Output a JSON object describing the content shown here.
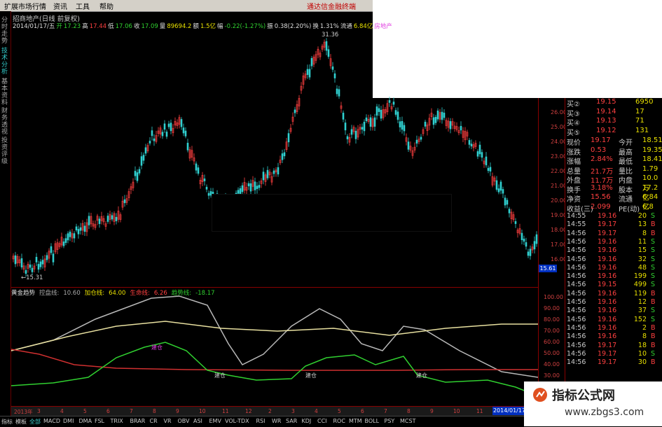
{
  "menubar": {
    "items": [
      "扩展市场行情",
      "资讯",
      "工具",
      "帮助"
    ],
    "ad": "通达信金融终端"
  },
  "left_tabs": [
    {
      "label": "分时走势",
      "active": false
    },
    {
      "label": "技术分析",
      "active": true
    },
    {
      "label": "基本资料",
      "active": false
    },
    {
      "label": "财务透视",
      "active": false
    },
    {
      "label": "投资评级",
      "active": false
    }
  ],
  "chart": {
    "title": "招商地产(日线 前复权)",
    "info": {
      "date": "2014/01/17/五",
      "open_label": "开",
      "open": "17.23",
      "high_label": "高",
      "high": "17.44",
      "low_label": "低",
      "low": "17.06",
      "close_label": "收",
      "close": "17.09",
      "vol_label": "量",
      "vol": "89694.2",
      "amount_label": "额",
      "amount": "1.5亿",
      "change_label": "幅",
      "change": "-0.22(-1.27%)",
      "amplitude_label": "振",
      "amplitude": "0.38(2.20%)",
      "turnover_label": "换",
      "turnover": "1.31%",
      "float_label": "流通",
      "float": "6.84亿",
      "sector": "房地产"
    },
    "max_label": "31.36",
    "min_label": "←15.31",
    "price_ticks": [
      "26.00",
      "25.00",
      "24.00",
      "23.00",
      "22.00",
      "21.00",
      "20.00",
      "19.00",
      "18.00",
      "17.00",
      "16.00"
    ],
    "price_tag": "15.61",
    "indicator": {
      "name": "黄金趋势",
      "l1_label": "控盘线:",
      "l1": "10.60",
      "l2_label": "加仓线:",
      "l2": "64.00",
      "l3_label": "生命线:",
      "l3": "6.26",
      "l4_label": "趋势线:",
      "l4": "-18.17",
      "markers": [
        "建仓",
        "建仓",
        "建仓",
        "建仓"
      ],
      "ticks": [
        "100.00",
        "90.00",
        "80.00",
        "70.00",
        "60.00",
        "50.00",
        "40.00",
        "30.00",
        "20.00",
        "10.00"
      ]
    },
    "time_labels": [
      "2013年",
      "3",
      "4",
      "5",
      "6",
      "7",
      "8",
      "9",
      "10",
      "11",
      "12",
      "2",
      "3",
      "4",
      "5",
      "6",
      "7",
      "8",
      "9",
      "10",
      "11",
      "12"
    ],
    "end_date": "2014/01/17"
  },
  "quote": {
    "bids": [
      {
        "label": "买②",
        "price": "19.15",
        "vol": "6950"
      },
      {
        "label": "买③",
        "price": "19.14",
        "vol": "17"
      },
      {
        "label": "买④",
        "price": "19.13",
        "vol": "71"
      },
      {
        "label": "买⑤",
        "price": "19.12",
        "vol": "131"
      }
    ],
    "stats": [
      {
        "l1": "现价",
        "v1": "19.17",
        "l2": "今开",
        "v2": "18.51"
      },
      {
        "l1": "涨跌",
        "v1": "0.53",
        "l2": "最高",
        "v2": "19.35"
      },
      {
        "l1": "涨幅",
        "v1": "2.84%",
        "l2": "最低",
        "v2": "18.41"
      },
      {
        "l1": "总量",
        "v1": "21.7万",
        "l2": "量比",
        "v2": "1.79"
      },
      {
        "l1": "外盘",
        "v1": "11.7万",
        "l2": "内盘",
        "v2": "10.0万"
      },
      {
        "l1": "换手",
        "v1": "3.18%",
        "l2": "股本",
        "v2": "17.2亿"
      },
      {
        "l1": "净资",
        "v1": "15.56",
        "l2": "流通",
        "v2": "6.84亿"
      },
      {
        "l1": "收益(三)",
        "v1": "2.099",
        "l2": "PE(动)",
        "v2": "6.8"
      }
    ],
    "fills": [
      {
        "t": "14:55",
        "p": "19.16",
        "v": "20",
        "d": "S"
      },
      {
        "t": "14:55",
        "p": "19.17",
        "v": "13",
        "d": "B"
      },
      {
        "t": "14:56",
        "p": "19.17",
        "v": "8",
        "d": "B"
      },
      {
        "t": "14:56",
        "p": "19.16",
        "v": "11",
        "d": "S"
      },
      {
        "t": "14:56",
        "p": "19.16",
        "v": "15",
        "d": "S"
      },
      {
        "t": "14:56",
        "p": "19.16",
        "v": "32",
        "d": "S"
      },
      {
        "t": "14:56",
        "p": "19.16",
        "v": "48",
        "d": "S"
      },
      {
        "t": "14:56",
        "p": "19.16",
        "v": "199",
        "d": "S"
      },
      {
        "t": "14:56",
        "p": "19.15",
        "v": "499",
        "d": "S"
      },
      {
        "t": "14:56",
        "p": "19.16",
        "v": "119",
        "d": "B"
      },
      {
        "t": "14:56",
        "p": "19.16",
        "v": "12",
        "d": "B"
      },
      {
        "t": "14:56",
        "p": "19.16",
        "v": "37",
        "d": "S"
      },
      {
        "t": "14:56",
        "p": "19.16",
        "v": "152",
        "d": "S"
      },
      {
        "t": "14:56",
        "p": "19.16",
        "v": "2",
        "d": "B"
      },
      {
        "t": "14:56",
        "p": "19.16",
        "v": "8",
        "d": "B"
      },
      {
        "t": "14:56",
        "p": "19.17",
        "v": "18",
        "d": "B"
      },
      {
        "t": "14:56",
        "p": "19.17",
        "v": "10",
        "d": "S"
      },
      {
        "t": "14:56",
        "p": "19.17",
        "v": "30",
        "d": "B"
      }
    ]
  },
  "statusbar": {
    "items": [
      "指标",
      "模板",
      "全部",
      "MACD",
      "DMI",
      "DMA",
      "FSL",
      "TRIX",
      "BRAR",
      "CR",
      "VR",
      "OBV",
      "ASI",
      "EMV",
      "VOL-TDX",
      "RSI",
      "WR",
      "SAR",
      "KDJ",
      "CCI",
      "ROC",
      "MTM",
      "BOLL",
      "PSY",
      "MCST"
    ]
  },
  "watermark": {
    "line1": "指标公式网",
    "line2": "www.zbgs3.com"
  },
  "colors": {
    "up": "#ff4040",
    "down": "#30d0d0",
    "bg": "#000000",
    "grid": "#800000"
  }
}
